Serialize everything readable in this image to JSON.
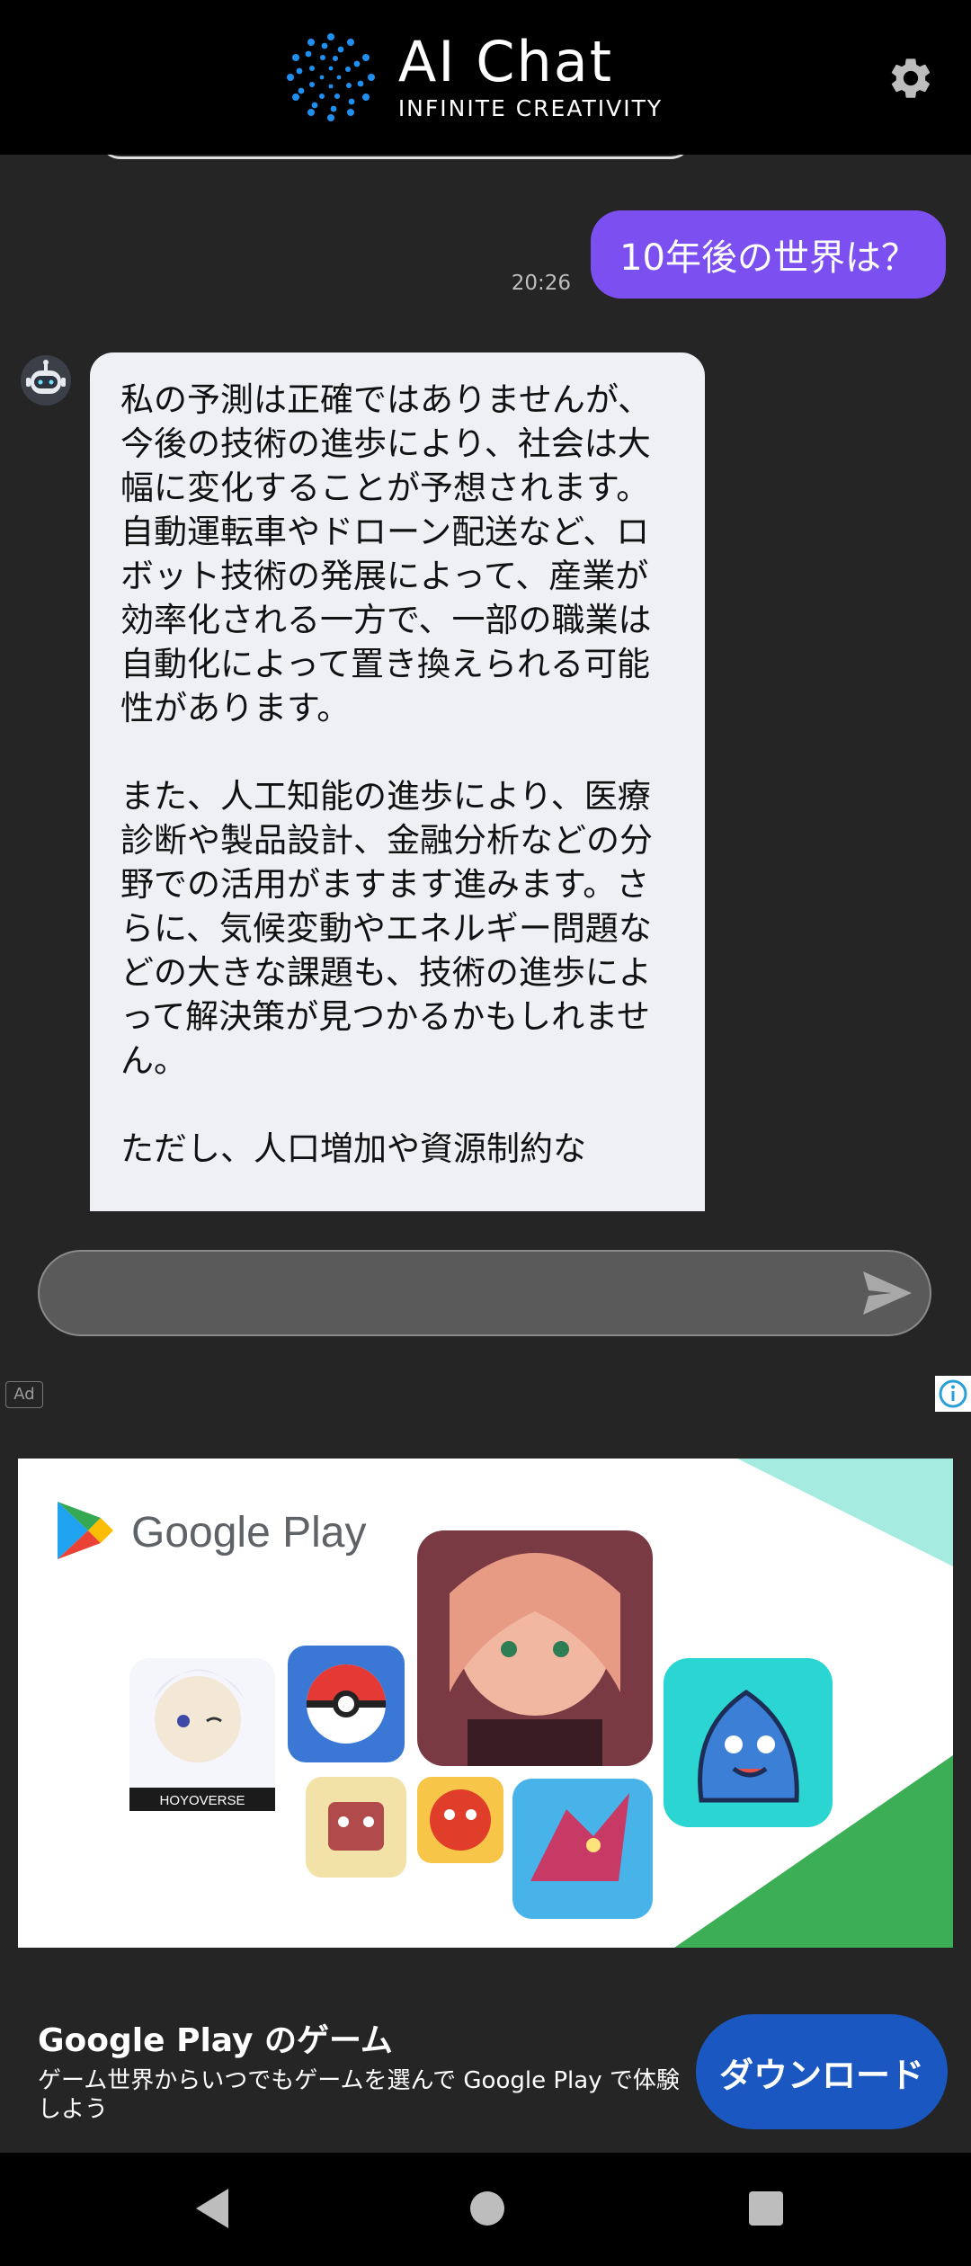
{
  "header": {
    "title": "AI Chat",
    "subtitle": "INFINITE CREATIVITY",
    "settings_icon": "gear-icon",
    "accent": "#1f7fe0"
  },
  "chat": {
    "messages": [
      {
        "role": "user",
        "text": "10年後の世界は？",
        "time": "20:26",
        "color": "#7c4ff0"
      },
      {
        "role": "bot",
        "avatar_icon": "robot-icon",
        "paragraphs": [
          "私の予測は正確ではありませんが、今後の技術の進歩により、社会は大幅に変化することが予想されます。自動運転車やドローン配送など、ロボット技術の発展によって、産業が効率化される一方で、一部の職業は自動化によって置き換えられる可能性があります。",
          "また、人工知能の進歩により、医療診断や製品設計、金融分析などの分野での活用がますます進みます。さらに、気候変動やエネルギー問題などの大きな課題も、技術の進歩によって解決策が見つかるかもしれません。",
          "ただし、人口増加や資源制約な"
        ]
      }
    ]
  },
  "input": {
    "value": "",
    "send_icon": "send-icon"
  },
  "ad": {
    "label": "Ad",
    "info_icon": "info-icon",
    "banner_brand": "Google Play",
    "banner_badge": "HOYOVERSE",
    "title": "Google Play のゲーム",
    "description": "ゲーム世界からいつでもゲームを選んで Google Play で体験しよう",
    "cta": "ダウンロード",
    "cta_color": "#1a57c0"
  },
  "navbar": {
    "back_icon": "back-triangle-icon",
    "home_icon": "home-circle-icon",
    "recents_icon": "recents-square-icon"
  }
}
